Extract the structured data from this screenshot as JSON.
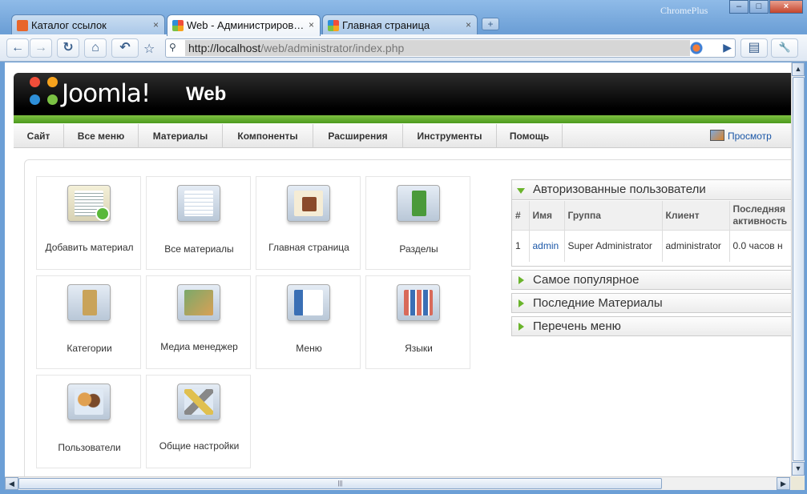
{
  "browser": {
    "brand": "ChromePlus",
    "tabs": [
      {
        "label": "Каталог ссылок",
        "close": "×",
        "favicon_color": "#e8652a"
      },
      {
        "label": "Web - Администриров…",
        "close": "×",
        "favicon_color": "#1a1a1a"
      },
      {
        "label": "Главная страница",
        "close": "×",
        "favicon_color": "#1a1a1a"
      }
    ],
    "new_tab": "+",
    "window_buttons": {
      "minimize": "–",
      "maximize": "□",
      "close": "×"
    },
    "toolbar": {
      "back": "←",
      "forward": "→",
      "reload": "↻",
      "home": "⌂",
      "undo": "↶",
      "star": "☆",
      "go": "▶",
      "page": "▤",
      "tools": "🔧"
    },
    "url_host": "http://localhost",
    "url_path": "/web/administrator/index.php"
  },
  "joomla": {
    "logo_text": "Joomla!",
    "site_name": "Web",
    "menu": [
      "Сайт",
      "Все меню",
      "Материалы",
      "Компоненты",
      "Расширения",
      "Инструменты",
      "Помощь"
    ],
    "preview": "Просмотр",
    "icons": [
      {
        "label": "Добавить материал",
        "icon": "add-article-icon",
        "color": "#f4f0d8"
      },
      {
        "label": "Все материалы",
        "icon": "all-articles-icon",
        "color": "#cfe0f2"
      },
      {
        "label": "Главная страница",
        "icon": "home-page-icon",
        "color": "#f5ecd5"
      },
      {
        "label": "Разделы",
        "icon": "sections-icon",
        "color": "#4a9a3a"
      },
      {
        "label": "Категории",
        "icon": "categories-icon",
        "color": "#c9a35a"
      },
      {
        "label": "Медиа менеджер",
        "icon": "media-manager-icon",
        "color": "#7ba96a"
      },
      {
        "label": "Меню",
        "icon": "menu-icon",
        "color": "#3a6fb5"
      },
      {
        "label": "Языки",
        "icon": "languages-icon",
        "color": "#d86a5a"
      },
      {
        "label": "Пользователи",
        "icon": "users-icon",
        "color": "#e0a050"
      },
      {
        "label": "Общие настройки",
        "icon": "global-config-icon",
        "color": "#e0c050"
      }
    ],
    "panels": {
      "logged_in": {
        "title": "Авторизованные пользователи",
        "columns": [
          "#",
          "Имя",
          "Группа",
          "Клиент",
          "Последняя активность"
        ],
        "rows": [
          {
            "num": "1",
            "name": "admin",
            "group": "Super Administrator",
            "client": "administrator",
            "activity": "0.0 часов н"
          }
        ]
      },
      "popular": "Самое популярное",
      "latest": "Последние Материалы",
      "menu_stats": "Перечень меню"
    }
  }
}
